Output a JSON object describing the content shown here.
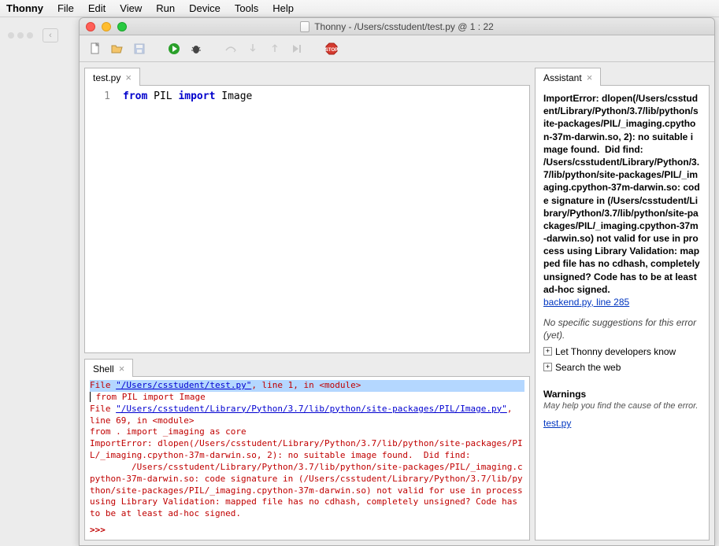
{
  "menubar": {
    "app": "Thonny",
    "items": [
      "File",
      "Edit",
      "View",
      "Run",
      "Device",
      "Tools",
      "Help"
    ]
  },
  "window": {
    "title": "Thonny  -  /Users/csstudent/test.py  @  1 : 22"
  },
  "editor": {
    "tab_label": "test.py",
    "line_num": "1",
    "code_from": "from",
    "code_mod": " PIL ",
    "code_import": "import",
    "code_name": " Image"
  },
  "shell": {
    "tab_label": "Shell",
    "l1a": "  File ",
    "l1b": "\"/Users/csstudent/test.py\"",
    "l1c": ", line 1, in <module>",
    "l2": "    from PIL import Image",
    "l3a": "  File ",
    "l3b": "\"/Users/csstudent/Library/Python/3.7/lib/python/site-packages/PIL/Image.py\"",
    "l3c": ", line 69, in <module>",
    "l4": "    from . import _imaging as core",
    "l5": "ImportError: dlopen(/Users/csstudent/Library/Python/3.7/lib/python/site-packages/PIL/_imaging.cpython-37m-darwin.so, 2): no suitable image found.  Did find:",
    "l6": "\t/Users/csstudent/Library/Python/3.7/lib/python/site-packages/PIL/_imaging.cpython-37m-darwin.so: code signature in (/Users/csstudent/Library/Python/3.7/lib/python/site-packages/PIL/_imaging.cpython-37m-darwin.so) not valid for use in process using Library Validation: mapped file has no cdhash, completely unsigned? Code has to be at least ad-hoc signed.",
    "prompt": ">>> "
  },
  "assistant": {
    "tab_label": "Assistant",
    "err_title": "ImportError: ",
    "err_body": "dlopen(/Users/csstudent/Library/Python/3.7/lib/python/site-packages/PIL/_imaging.cpython-37m-darwin.so, 2): no suitable image found.  Did find:\n/Users/csstudent/Library/Python/3.7/lib/python/site-packages/PIL/_imaging.cpython-37m-darwin.so: code signature in (/Users/csstudent/Library/Python/3.7/lib/python/site-packages/PIL/_imaging.cpython-37m-darwin.so) not valid for use in process using Library Validation: mapped file has no cdhash, completely unsigned? Code has to be at least ad-hoc signed.",
    "err_link": "backend.py, line 285",
    "no_suggest": "No specific suggestions for this error (yet).",
    "item1": "Let Thonny developers know",
    "item2": "Search the web",
    "warnings_title": "Warnings",
    "warnings_sub": "May help you find the cause of the error.",
    "warn_link": "test.py"
  }
}
